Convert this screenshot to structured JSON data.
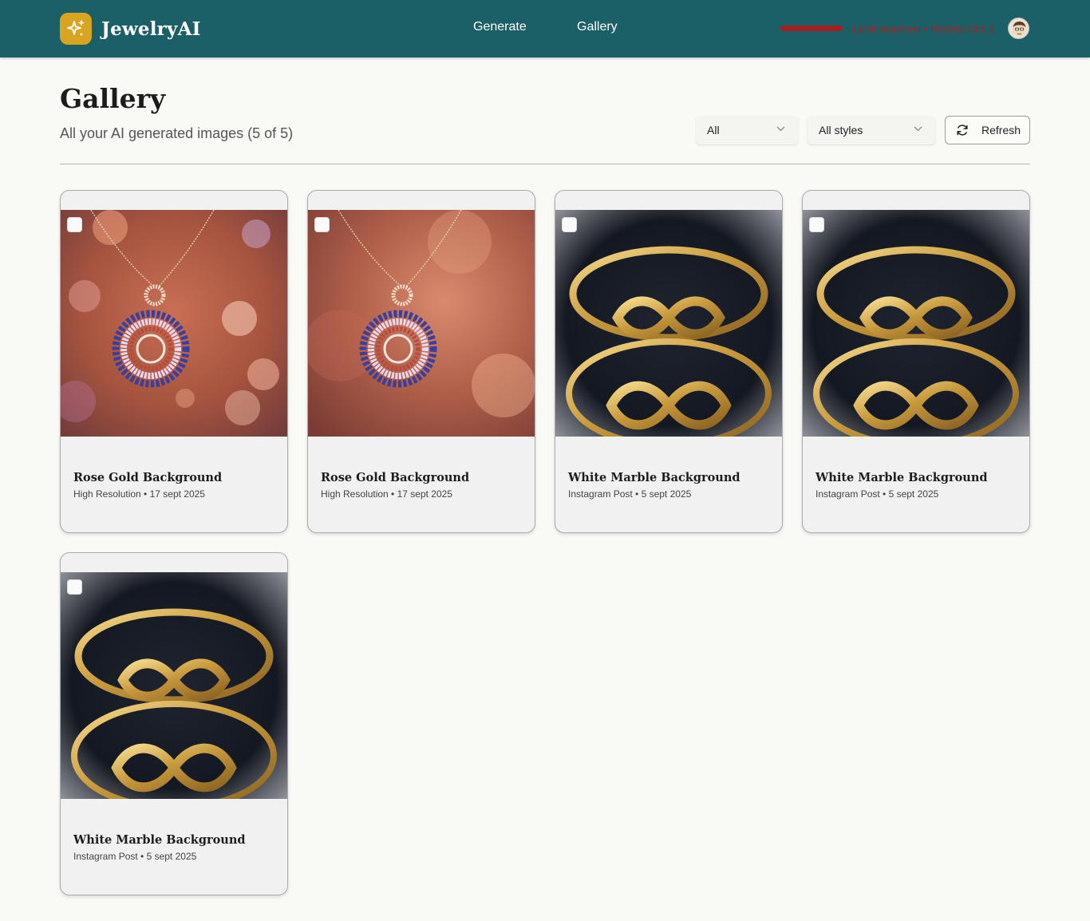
{
  "header": {
    "app_name": "JewelryAI",
    "nav": {
      "generate": "Generate",
      "gallery": "Gallery"
    },
    "limit_status": "Limit reached • Resets Oct 1",
    "limit_progress_percent": 100,
    "brand_color": "#1b5f67",
    "logo_color": "#d9a520",
    "limit_color": "#a61f1f"
  },
  "page": {
    "title": "Gallery",
    "subtitle": "All your AI generated images (5 of 5)"
  },
  "filters": {
    "type_selected": "All",
    "style_selected": "All styles",
    "refresh_label": "Refresh"
  },
  "cards": [
    {
      "title": "Rose Gold Background",
      "meta": "High Resolution • 17 sept 2025",
      "image": "pendant-necklace-rose-bokeh"
    },
    {
      "title": "Rose Gold Background",
      "meta": "High Resolution • 17 sept 2025",
      "image": "pendant-necklace-rose-bokeh"
    },
    {
      "title": "White Marble Background",
      "meta": "Instagram Post • 5 sept 2025",
      "image": "gold-infinity-rings-dark"
    },
    {
      "title": "White Marble Background",
      "meta": "Instagram Post • 5 sept 2025",
      "image": "gold-infinity-rings-dark"
    },
    {
      "title": "White Marble Background",
      "meta": "Instagram Post • 5 sept 2025",
      "image": "gold-infinity-rings-dark"
    }
  ]
}
